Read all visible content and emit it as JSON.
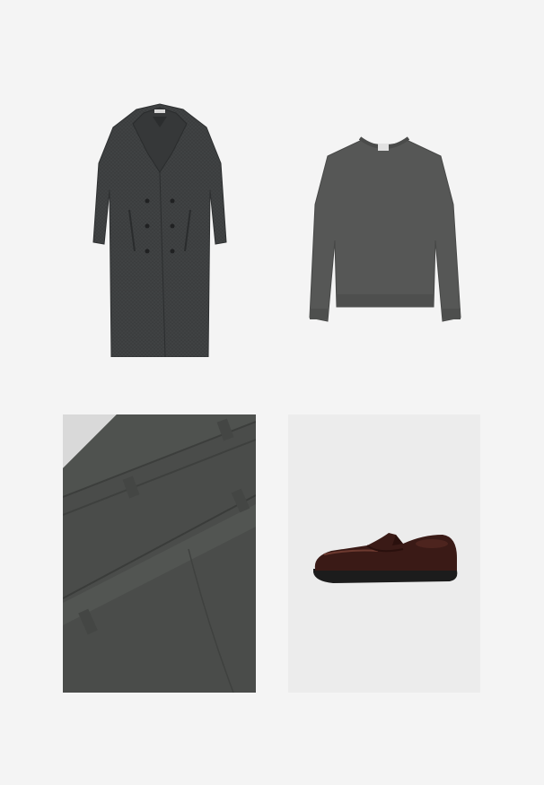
{
  "board": {
    "items": [
      {
        "kind": "coat",
        "color": "#3c3e3f"
      },
      {
        "kind": "sweater",
        "color": "#565756"
      },
      {
        "kind": "trousers",
        "color": "#4a4c4a"
      },
      {
        "kind": "loafer",
        "color": "#3a1a16"
      }
    ],
    "background": "#f4f4f4"
  }
}
